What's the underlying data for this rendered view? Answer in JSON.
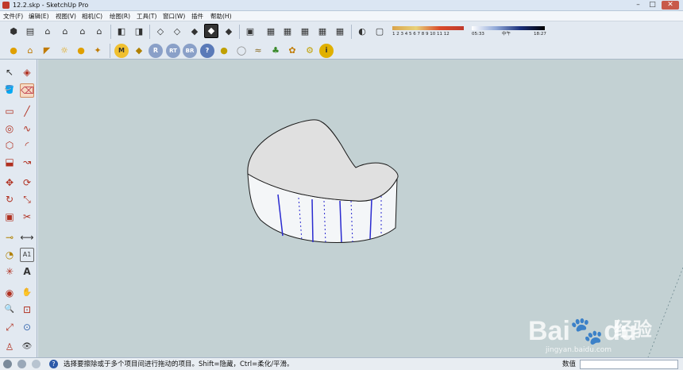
{
  "window": {
    "title": "12.2.skp - SketchUp Pro",
    "controls": {
      "minimize": "–",
      "maximize": "□",
      "close": "✕"
    }
  },
  "menu": [
    "文件(F)",
    "编辑(E)",
    "视图(V)",
    "相机(C)",
    "绘图(R)",
    "工具(T)",
    "窗口(W)",
    "插件",
    "帮助(H)"
  ],
  "toolbar": {
    "views": [
      "iso-view-icon",
      "top-view-icon",
      "front-view-icon",
      "right-view-icon",
      "back-view-icon",
      "left-view-icon"
    ],
    "styles": [
      "xray-icon",
      "back-edges-icon",
      "wireframe-icon",
      "hidden-line-icon",
      "shaded-icon",
      "shaded-texture-icon",
      "monochrome-icon"
    ],
    "layers_scenes": [
      "components-icon",
      "section-plane-icon",
      "section-display-icon",
      "section-cut-icon",
      "model-info-icon",
      "outliner-icon",
      "shadow-settings-icon",
      "fog-icon"
    ],
    "shadows": {
      "months": "1 2 3 4 5 6 7 8 9 10 11 12",
      "time_start": "05:33",
      "time_mid": "中午",
      "time_end": "18:27"
    }
  },
  "toolbar2": {
    "lights": [
      "bulb-icon-1",
      "lamp-icon",
      "spotlight-icon",
      "sun-icon",
      "bulb-icon-2",
      "light-settings-icon"
    ],
    "render": [
      {
        "name": "m-render-icon",
        "glyph": "M"
      },
      {
        "name": "render-region-icon",
        "glyph": "◆"
      },
      {
        "name": "r-render-icon",
        "glyph": "R"
      },
      {
        "name": "rt-render-icon",
        "glyph": "RT"
      },
      {
        "name": "br-render-icon",
        "glyph": "BR"
      },
      {
        "name": "help-icon",
        "glyph": "?"
      },
      {
        "name": "material-icon",
        "glyph": "●"
      },
      {
        "name": "sphere-icon",
        "glyph": "◯"
      },
      {
        "name": "terrain-icon",
        "glyph": "≈"
      },
      {
        "name": "tree-icon",
        "glyph": "♣"
      },
      {
        "name": "plant-icon",
        "glyph": "✿"
      },
      {
        "name": "gear-icon",
        "glyph": "⚙"
      },
      {
        "name": "info-icon",
        "glyph": "i"
      }
    ]
  },
  "left_tools": [
    {
      "name": "select-tool-icon",
      "glyph": "↖"
    },
    {
      "name": "component-tool-icon",
      "glyph": "◈"
    },
    {
      "name": "paint-bucket-icon",
      "glyph": "🪣"
    },
    {
      "name": "eraser-tool-icon",
      "glyph": "⌫",
      "active": true
    },
    {
      "name": "rectangle-tool-icon",
      "glyph": "▭"
    },
    {
      "name": "line-tool-icon",
      "glyph": "╱"
    },
    {
      "name": "circle-tool-icon",
      "glyph": "◎"
    },
    {
      "name": "freehand-tool-icon",
      "glyph": "∿"
    },
    {
      "name": "polygon-tool-icon",
      "glyph": "⬡"
    },
    {
      "name": "arc-tool-icon",
      "glyph": "◜"
    },
    {
      "name": "push-pull-icon",
      "glyph": "⬓"
    },
    {
      "name": "follow-me-icon",
      "glyph": "↝"
    },
    {
      "name": "move-tool-icon",
      "glyph": "✥"
    },
    {
      "name": "rotate-tool-icon",
      "glyph": "⟳"
    },
    {
      "name": "rotate-copy-icon",
      "glyph": "↻"
    },
    {
      "name": "scale-tool-icon",
      "glyph": "⤡"
    },
    {
      "name": "offset-tool-icon",
      "glyph": "▣"
    },
    {
      "name": "intersect-icon",
      "glyph": "✂"
    },
    {
      "name": "tape-measure-icon",
      "glyph": "⊸"
    },
    {
      "name": "dimension-tool-icon",
      "glyph": "⟷"
    },
    {
      "name": "protractor-icon",
      "glyph": "◔"
    },
    {
      "name": "text-tool-icon",
      "glyph": "A1"
    },
    {
      "name": "axes-tool-icon",
      "glyph": "✳"
    },
    {
      "name": "3d-text-icon",
      "glyph": "A"
    },
    {
      "name": "orbit-tool-icon",
      "glyph": "◉"
    },
    {
      "name": "pan-tool-icon",
      "glyph": "✋"
    },
    {
      "name": "zoom-tool-icon",
      "glyph": "🔍"
    },
    {
      "name": "zoom-window-icon",
      "glyph": "⊡"
    },
    {
      "name": "zoom-extents-icon",
      "glyph": "⤢"
    },
    {
      "name": "previous-view-icon",
      "glyph": "⊙"
    },
    {
      "name": "position-camera-icon",
      "glyph": "♙"
    },
    {
      "name": "look-around-icon",
      "glyph": "👁"
    }
  ],
  "status": {
    "message": "选择要擦除或于多个项目间进行拖动的项目。Shift=隐藏，Ctrl=柔化/平滑。",
    "measure_label": "数值",
    "measure_value": ""
  },
  "colors": {
    "viewport_bg": "#c3d1d3",
    "model_top": "#e0e0e0",
    "model_side": "#f4f6f8",
    "edge_dark": "#1a1a1a",
    "edge_blue": "#2a2ad0",
    "active_tool": "#f5d9c2"
  }
}
